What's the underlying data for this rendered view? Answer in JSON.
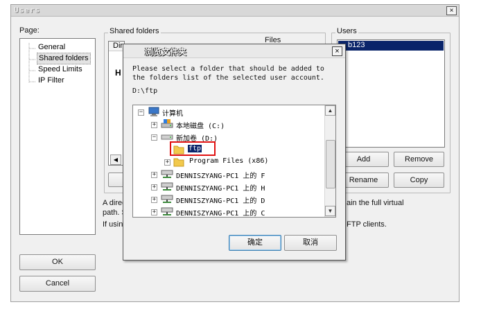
{
  "users_window": {
    "title": "Users",
    "close_glyph": "×",
    "page_label": "Page:",
    "pages": [
      {
        "label": "General"
      },
      {
        "label": "Shared folders",
        "selected": true
      },
      {
        "label": "Speed Limits"
      },
      {
        "label": "IP Filter"
      }
    ],
    "shared_folders_label": "Shared folders",
    "directories_header_partial": "Dir",
    "files_label": "Files",
    "h_partial": "H",
    "users_label": "Users",
    "selected_user_partial": "b123",
    "buttons": {
      "add": "Add",
      "remove": "Remove",
      "rename": "Rename",
      "copy": "Copy",
      "ok": "OK",
      "cancel": "Cancel"
    },
    "info_lines": [
      "A direc",
      "path. S",
      "If usin"
    ],
    "info_right_lines": [
      "ain the full virtual",
      "FTP clients."
    ]
  },
  "browse_dialog": {
    "title": "浏览文件夹",
    "close_glyph": "×",
    "description_line1": "Please select a folder that should be added to",
    "description_line2": "the folders list of the selected user account.",
    "current_path": "D:\\ftp",
    "tree": {
      "computer": "计算机",
      "local_disk_c": "本地磁盘 (C:)",
      "new_volume_d": "新加卷 (D:)",
      "ftp_folder": "ftp",
      "program_files": "Program Files (x86)",
      "net_f": "DENNISZYANG-PC1 上的 F",
      "net_h": "DENNISZYANG-PC1 上的 H",
      "net_d": "DENNISZYANG-PC1 上的 D",
      "net_c": "DENNISZYANG-PC1 上的 C"
    },
    "buttons": {
      "ok": "确定",
      "cancel": "取消"
    },
    "highlight_color": "#e01010"
  },
  "icons": {
    "computer": "computer-icon",
    "drive": "drive-icon",
    "folder": "folder-icon",
    "network_drive": "network-drive-icon"
  }
}
